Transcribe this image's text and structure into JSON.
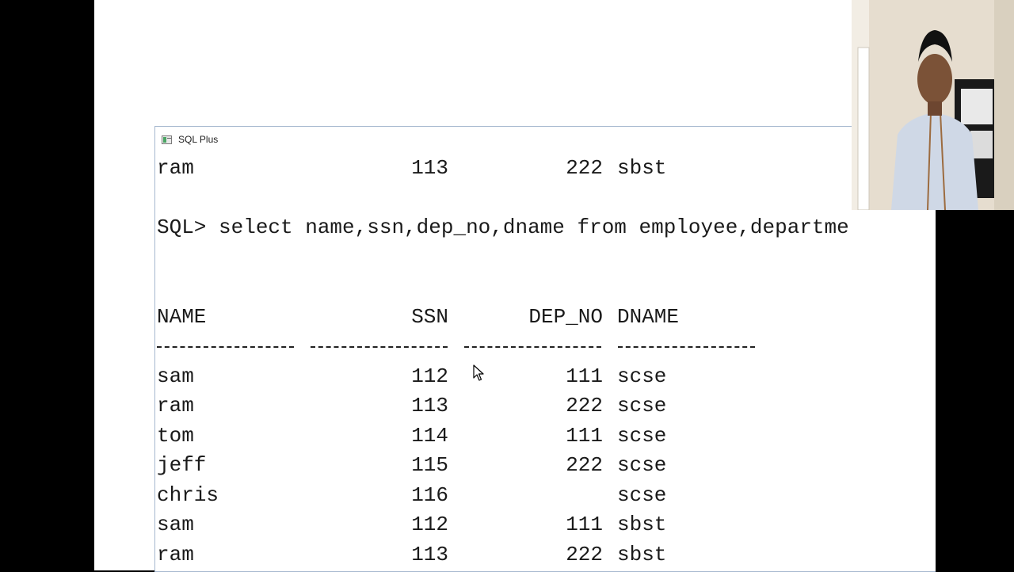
{
  "window": {
    "title": "SQL Plus"
  },
  "console": {
    "prev_row": {
      "name": "ram",
      "ssn": "113",
      "dep_no": "222",
      "dname": "sbst"
    },
    "prompt_line": "SQL> select name,ssn,dep_no,dname from employee,departme",
    "headers": {
      "name": "NAME",
      "ssn": "SSN",
      "dep_no": "DEP_NO",
      "dname": "DNAME"
    },
    "rows": [
      {
        "name": "sam",
        "ssn": "112",
        "dep_no": "111",
        "dname": "scse"
      },
      {
        "name": "ram",
        "ssn": "113",
        "dep_no": "222",
        "dname": "scse"
      },
      {
        "name": "tom",
        "ssn": "114",
        "dep_no": "111",
        "dname": "scse"
      },
      {
        "name": "jeff",
        "ssn": "115",
        "dep_no": "222",
        "dname": "scse"
      },
      {
        "name": "chris",
        "ssn": "116",
        "dep_no": "",
        "dname": "scse"
      },
      {
        "name": "sam",
        "ssn": "112",
        "dep_no": "111",
        "dname": "sbst"
      },
      {
        "name": "ram",
        "ssn": "113",
        "dep_no": "222",
        "dname": "sbst"
      }
    ]
  },
  "icons": {
    "app": "sqlplus-app-icon",
    "cursor": "mouse-pointer-icon"
  },
  "colors": {
    "window_border": "#a6b8cf",
    "background": "#ffffff",
    "text": "#1a1a1a"
  }
}
